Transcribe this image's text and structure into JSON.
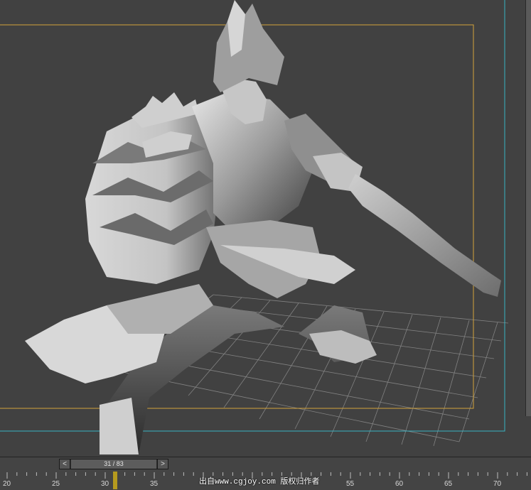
{
  "viewport": {
    "colors": {
      "background": "#414141",
      "grid": "#8e8e8e",
      "safe_frame": "#d2a23a",
      "render_frame": "#38b3c4",
      "model": "#bcbcbc"
    }
  },
  "timeline": {
    "prev_label": "<",
    "next_label": ">",
    "frame_counter": "31 / 83",
    "current_frame": 31,
    "total_frames": 83,
    "ticks": [
      "20",
      "25",
      "30",
      "35",
      "55",
      "60",
      "65",
      "70"
    ],
    "colors": {
      "playhead": "#b59a1e"
    }
  },
  "watermark": "出自www.cgjoy.com 版权归作者"
}
